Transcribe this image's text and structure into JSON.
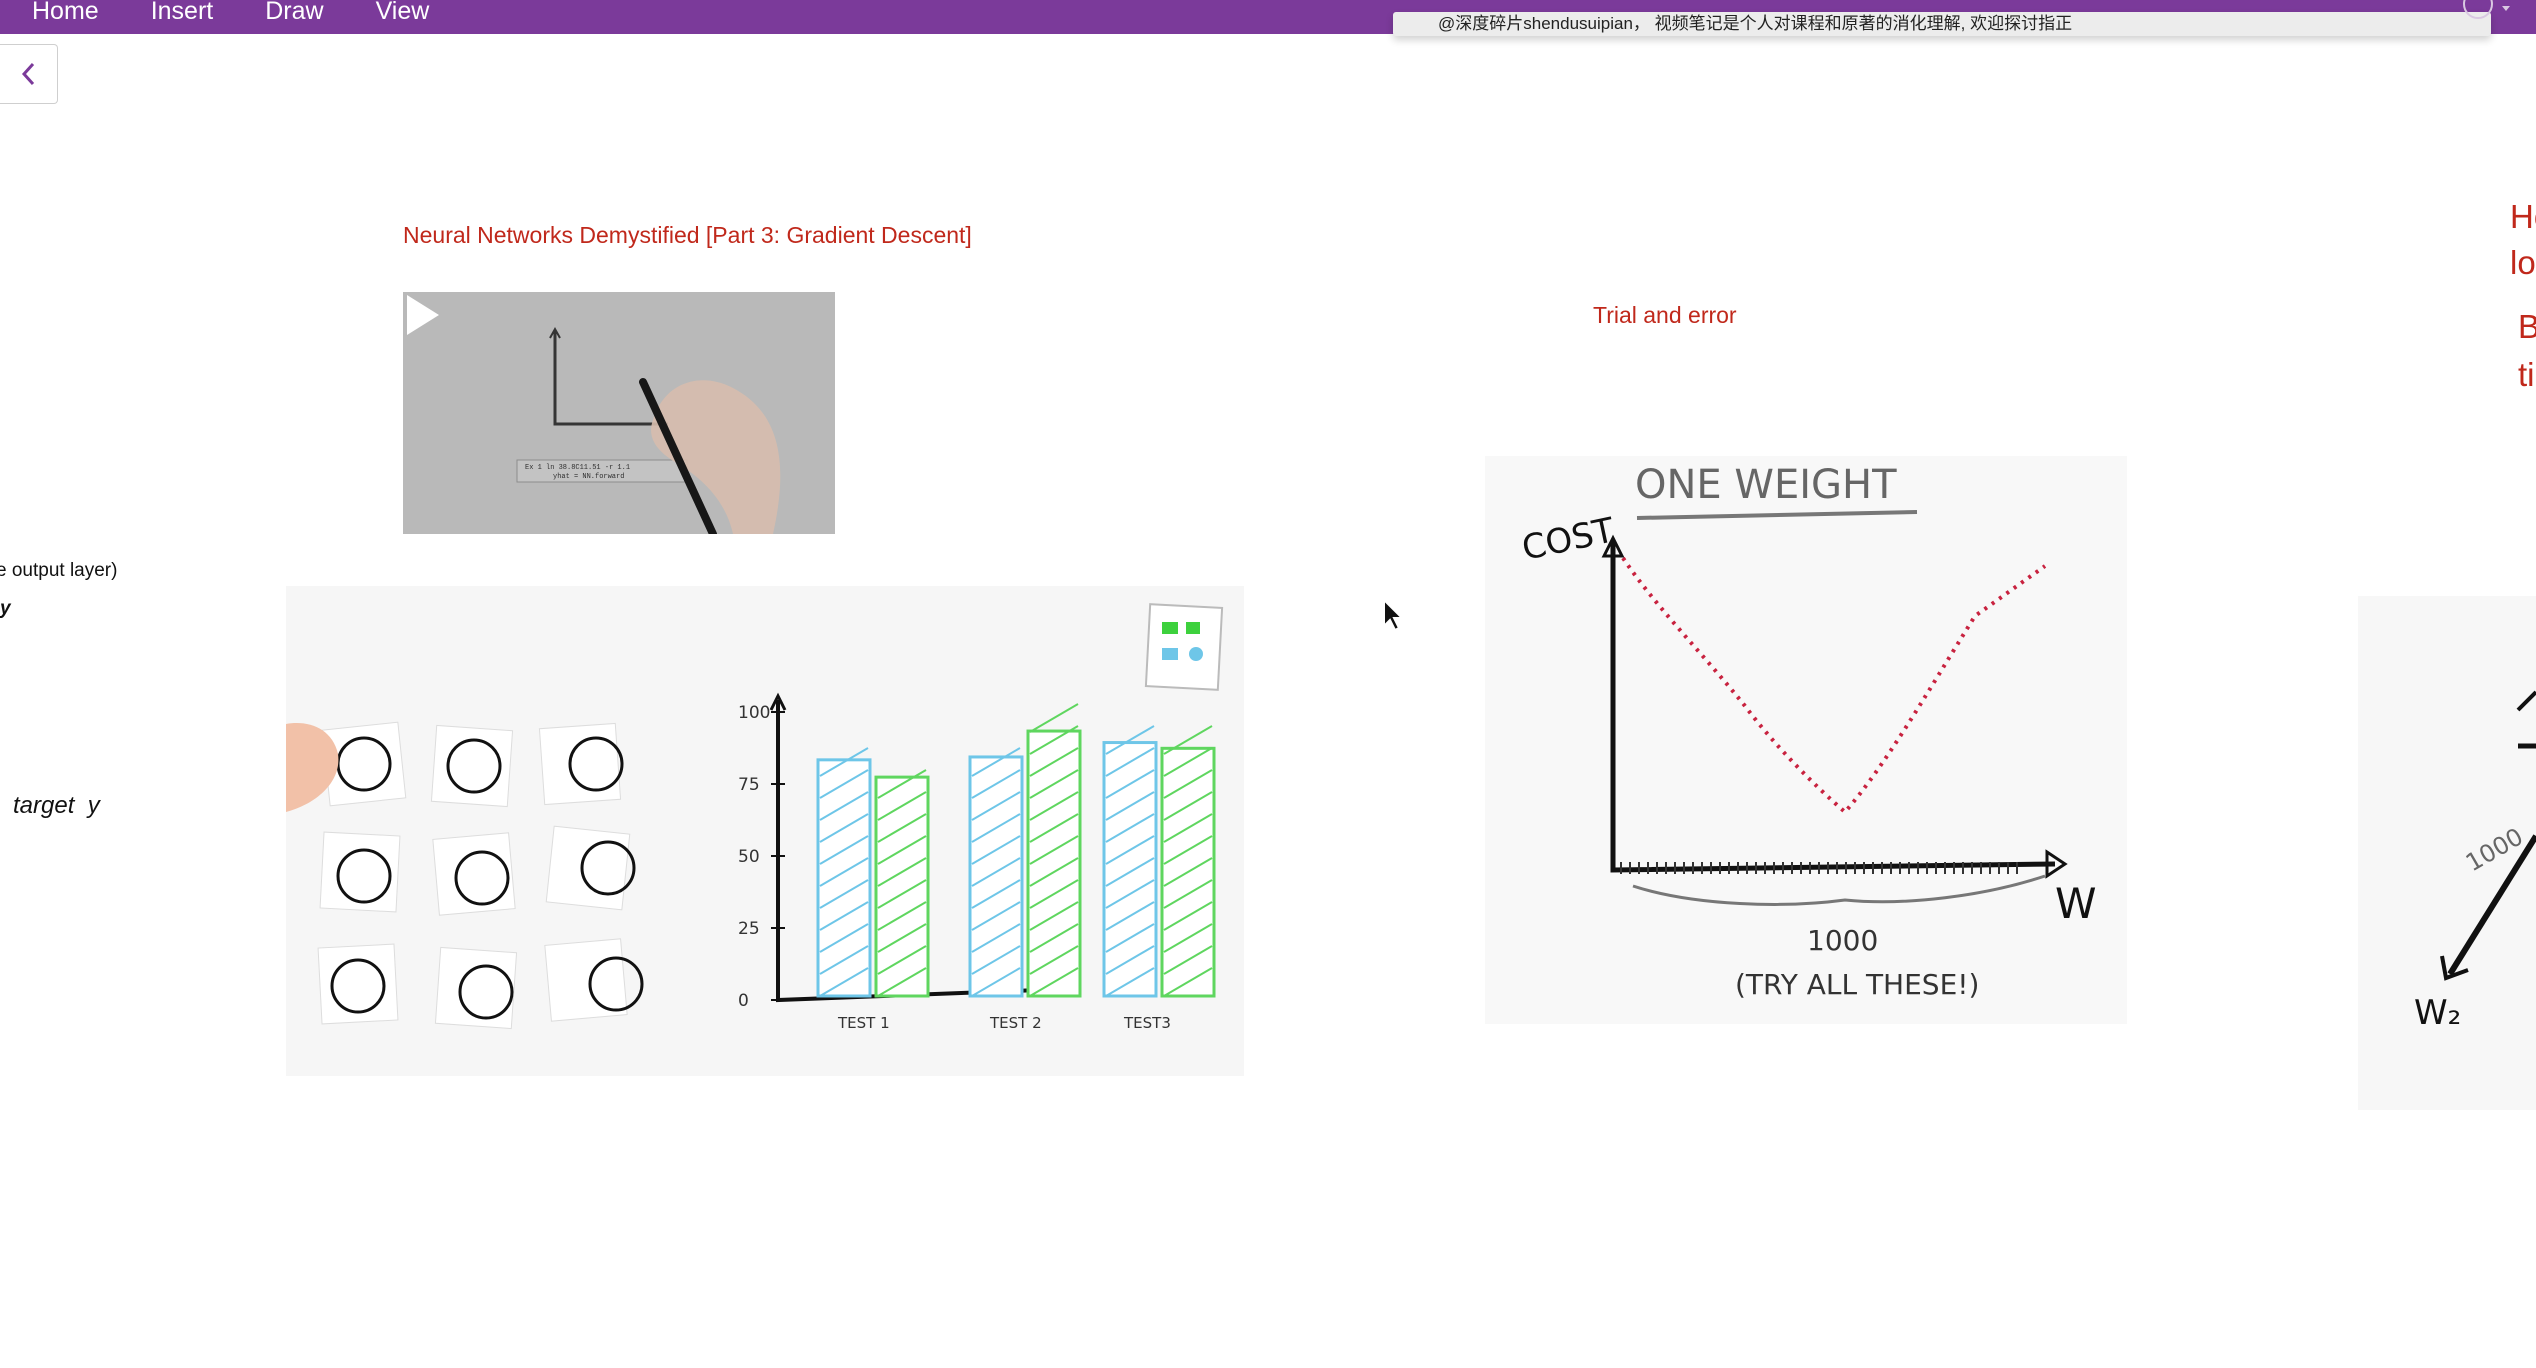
{
  "menu": {
    "items": [
      "Home",
      "Insert",
      "Draw",
      "View"
    ]
  },
  "notice": {
    "text": "@深度碎片shendusuipian， 视频笔记是个人对课程和原著的消化理解, 欢迎探讨指正"
  },
  "page": {
    "video_title": "Neural Networks Demystified [Part 3: Gradient Descent]",
    "trial_text": "Trial and error",
    "left_clipped": [
      "e output layer)",
      "y",
      "target  y"
    ],
    "right_clipped": [
      "Ho",
      "lo",
      "B",
      "ti"
    ]
  },
  "video_thumb": {
    "code_line1": "Ex 1 ln 38.8C11.51 -r 1.1",
    "code_line2": "yhat = NN.forward"
  },
  "bar_drawing": {
    "y_ticks": [
      "100",
      "75",
      "50",
      "25",
      "0"
    ],
    "categories": [
      "TEST 1",
      "TEST 2",
      "TEST3"
    ],
    "series": [
      {
        "color": "#6ec6e8",
        "values": [
          82,
          83,
          88
        ]
      },
      {
        "color": "#5fd65f",
        "values": [
          76,
          92,
          86
        ]
      }
    ]
  },
  "weight_drawing": {
    "title": "ONE WEIGHT",
    "y_label": "COST",
    "x_label": "W",
    "count_label": "1000",
    "note": "(TRY ALL THESE!)"
  },
  "right_drawing": {
    "label_w2": "W₂",
    "label_1000": "1000"
  },
  "icons": [
    "chevron-left-icon",
    "play-icon",
    "account-icon",
    "cursor-icon"
  ]
}
